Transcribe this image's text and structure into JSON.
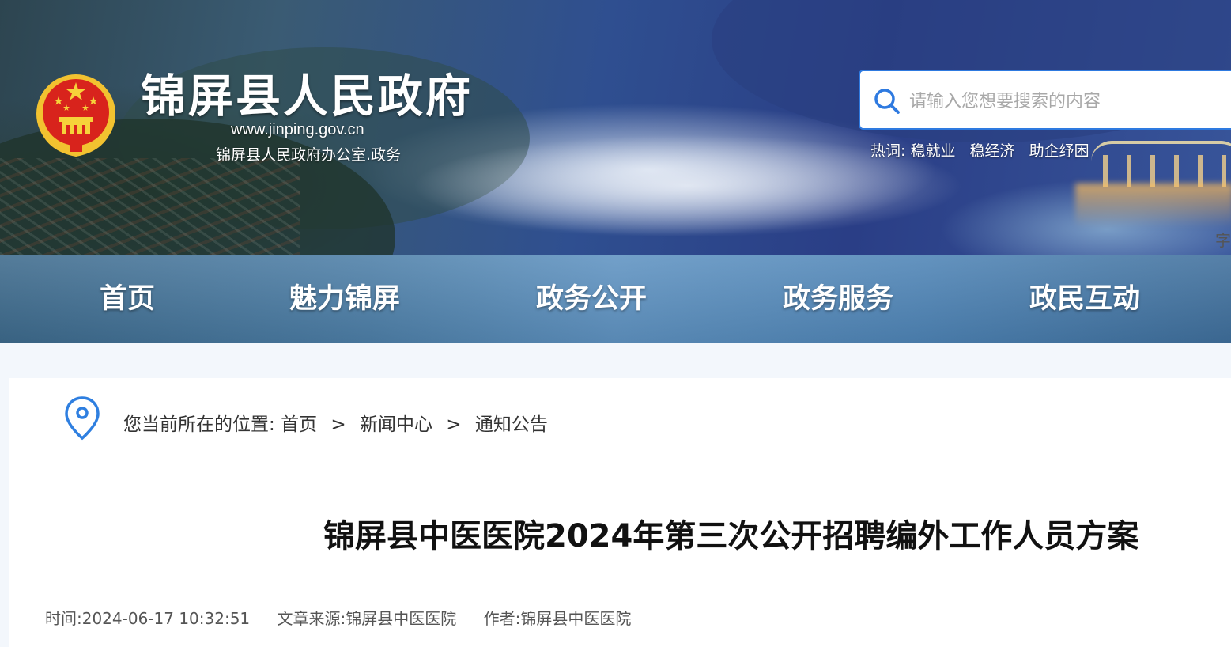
{
  "header": {
    "title": "锦屏县人民政府",
    "domain": "www.jinping.gov.cn",
    "subtitle": "锦屏县人民政府办公室.政务",
    "emblem_icon": "national-emblem-icon"
  },
  "search": {
    "placeholder": "请输入您想要搜索的内容",
    "value": "",
    "accent_color": "#2e7ae0",
    "hot_label": "热词:",
    "hot_words": [
      "稳就业",
      "稳经济",
      "助企纾困"
    ]
  },
  "nav": {
    "items": [
      "首页",
      "魅力锦屏",
      "政务公开",
      "政务服务",
      "政民互动"
    ]
  },
  "breadcrumb": {
    "prefix": "您当前所在的位置:",
    "items": [
      "首页",
      "新闻中心",
      "通知公告"
    ],
    "separator": ">",
    "icon": "location-pin-icon"
  },
  "article": {
    "title": "锦屏县中医医院2024年第三次公开招聘编外工作人员方案",
    "time": "时间:2024-06-17 10:32:51",
    "source": "文章来源:锦屏县中医医院",
    "author": "作者:锦屏县中医医院",
    "truncated_edge": "字"
  }
}
